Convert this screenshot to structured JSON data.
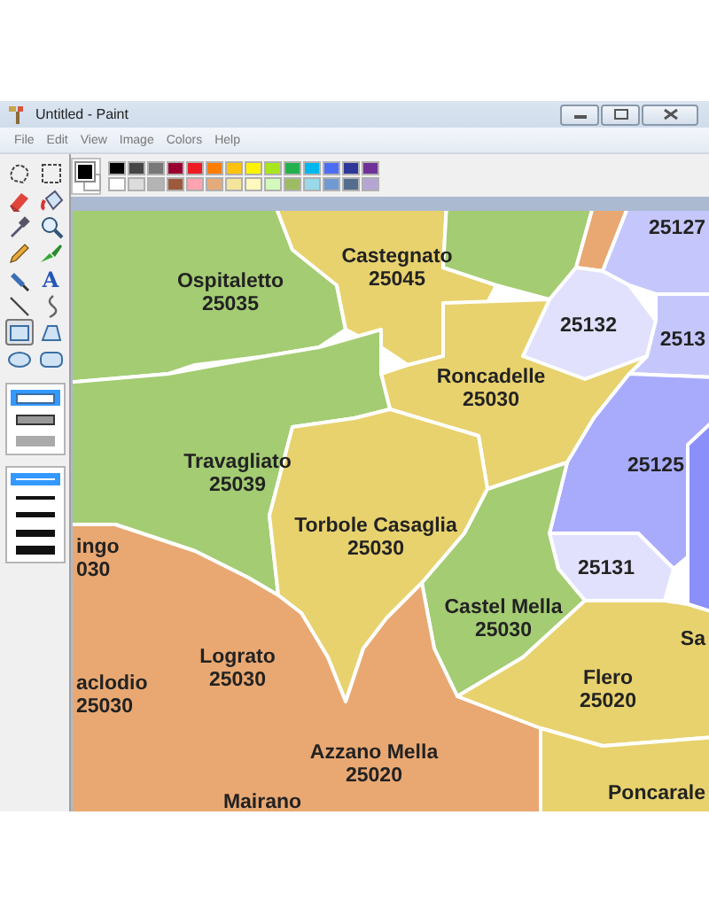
{
  "window": {
    "title": "Untitled - Paint"
  },
  "menu": [
    "File",
    "Edit",
    "View",
    "Image",
    "Colors",
    "Help"
  ],
  "palette": [
    {
      "color": "#000000"
    },
    {
      "color": "#464646"
    },
    {
      "color": "#787878"
    },
    {
      "color": "#990030"
    },
    {
      "color": "#ed1c24"
    },
    {
      "color": "#ff7e00"
    },
    {
      "color": "#ffc20e"
    },
    {
      "color": "#fff200"
    },
    {
      "color": "#a8e61d"
    },
    {
      "color": "#22b14c"
    },
    {
      "color": "#00b7ef"
    },
    {
      "color": "#4d6df3"
    },
    {
      "color": "#2f3699"
    },
    {
      "color": "#6f3198"
    },
    {
      "color": "#ffffff"
    },
    {
      "color": "#dcdcdc"
    },
    {
      "color": "#b4b4b4"
    },
    {
      "color": "#9c5a3c"
    },
    {
      "color": "#ffa3b1"
    },
    {
      "color": "#e5aa7a"
    },
    {
      "color": "#f5e49c"
    },
    {
      "color": "#fff9bd"
    },
    {
      "color": "#d3f9bc"
    },
    {
      "color": "#9dbb61"
    },
    {
      "color": "#99d9ea"
    },
    {
      "color": "#709ad1"
    },
    {
      "color": "#546d8e"
    },
    {
      "color": "#b5a5d5"
    }
  ],
  "tools": [
    {
      "selected": false
    },
    {
      "selected": false
    },
    {
      "selected": false
    },
    {
      "selected": false
    },
    {
      "selected": false
    },
    {
      "selected": false
    },
    {
      "selected": false
    },
    {
      "selected": false
    },
    {
      "selected": false
    },
    {
      "glyph": "A",
      "selected": false
    },
    {
      "selected": false
    },
    {
      "selected": false
    },
    {
      "selected": true
    },
    {
      "selected": false
    },
    {
      "selected": false
    },
    {
      "selected": false
    }
  ],
  "fill_styles": [
    {
      "selected": true
    },
    {
      "selected": false
    },
    {
      "selected": false
    }
  ],
  "line_widths": [
    {
      "selected": true
    },
    {
      "selected": false
    },
    {
      "selected": false
    },
    {
      "selected": false
    },
    {
      "selected": false
    }
  ],
  "map": {
    "areas": [
      {
        "color": "#a4cc73"
      },
      {
        "color": "#e8d26e"
      },
      {
        "color": "#a4cc73"
      },
      {
        "color": "#e9a872"
      },
      {
        "color": "#c5c7fc"
      },
      {
        "color": "#e1e1fd"
      },
      {
        "color": "#c5c7fc"
      },
      {
        "color": "#e8d26e"
      },
      {
        "color": "#a4cc73"
      },
      {
        "color": "#a8abfb"
      },
      {
        "color": "#8b8ff9"
      },
      {
        "color": "#e1e1fd"
      },
      {
        "color": "#e8d26e"
      },
      {
        "color": "#a4cc73"
      },
      {
        "color": "#e9a872"
      },
      {
        "color": "#e8d26e"
      },
      {
        "color": "#e8d26e"
      }
    ],
    "labels": [
      {
        "name": "Ospitaletto",
        "code": "25035"
      },
      {
        "name": "Castegnato",
        "code": "25045"
      },
      {
        "code": "25127"
      },
      {
        "code": "25132"
      },
      {
        "code": "2513"
      },
      {
        "name": "Roncadelle",
        "code": "25030"
      },
      {
        "name": "Travagliato",
        "code": "25039"
      },
      {
        "code": "25125"
      },
      {
        "name": "Torbole Casaglia",
        "code": "25030"
      },
      {
        "name": "ingo",
        "code": "030"
      },
      {
        "code": "25131"
      },
      {
        "name": "Castel Mella",
        "code": "25030"
      },
      {
        "name": "Sa"
      },
      {
        "name": "Lograto",
        "code": "25030"
      },
      {
        "name": "aclodio",
        "code": "25030"
      },
      {
        "name": "Flero",
        "code": "25020"
      },
      {
        "name": "Azzano Mella",
        "code": "25020"
      },
      {
        "name": "Poncarale"
      },
      {
        "name": "Mairano"
      }
    ]
  }
}
